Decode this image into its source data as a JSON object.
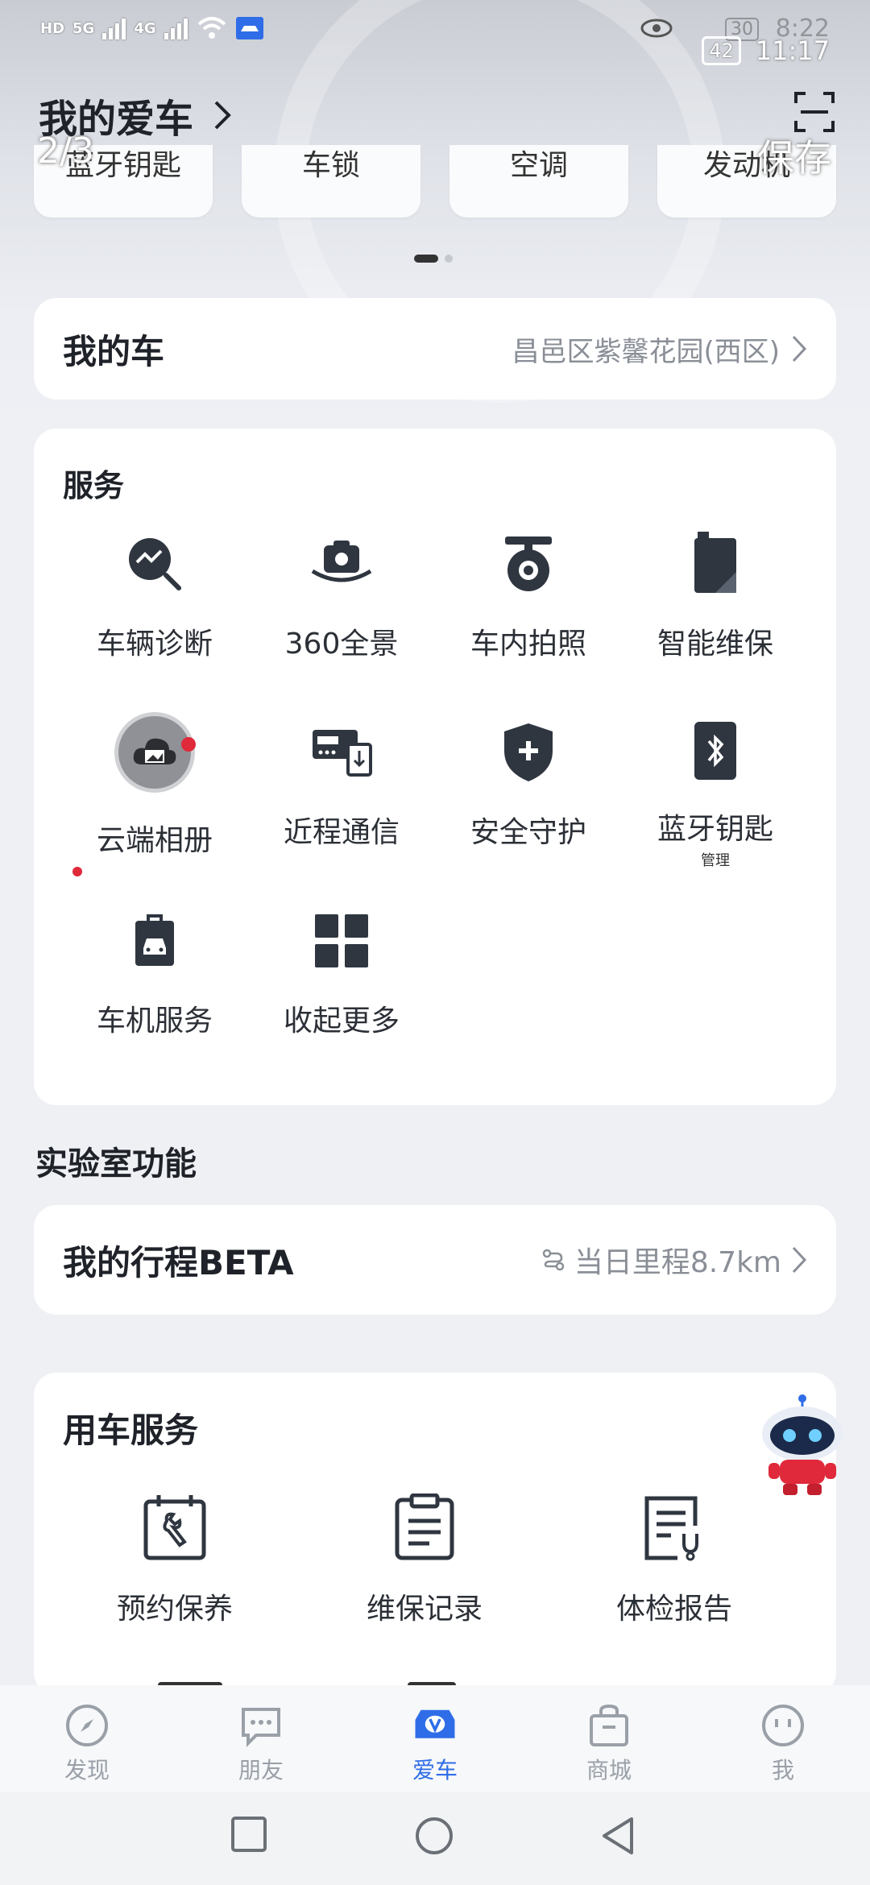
{
  "status_bar": {
    "left_chips": [
      "HD",
      "5G",
      "4G",
      "HD"
    ],
    "battery": "42",
    "time": "11:17",
    "ghost_battery": "30",
    "ghost_time": "8:22"
  },
  "header": {
    "title": "我的爱车",
    "page_indicator": "2/3",
    "save_label": "保存"
  },
  "quick_tiles": [
    "蓝牙钥匙",
    "车锁",
    "空调",
    "发动机"
  ],
  "my_car": {
    "title": "我的车",
    "location": "昌邑区紫馨花园(西区)"
  },
  "services": {
    "title": "服务",
    "items": [
      {
        "label": "车辆诊断",
        "icon": "diagnosis-icon"
      },
      {
        "label": "360全景",
        "icon": "camera-360-icon"
      },
      {
        "label": "车内拍照",
        "icon": "in-car-camera-icon"
      },
      {
        "label": "智能维保",
        "icon": "maintenance-icon"
      },
      {
        "label": "云端相册",
        "icon": "cloud-album-icon"
      },
      {
        "label": "近程通信",
        "icon": "near-communication-icon"
      },
      {
        "label": "安全守护",
        "icon": "shield-icon"
      },
      {
        "label": "蓝牙钥匙",
        "icon": "bluetooth-key-icon",
        "sub": "管理"
      },
      {
        "label": "车机服务",
        "icon": "car-service-icon"
      },
      {
        "label": "收起更多",
        "icon": "grid-icon"
      }
    ]
  },
  "lab": {
    "heading": "实验室功能",
    "trip_title": "我的行程BETA",
    "trip_value": "当日里程8.7km"
  },
  "use_car": {
    "title": "用车服务",
    "items": [
      {
        "label": "预约保养",
        "icon": "wrench-calendar-icon"
      },
      {
        "label": "维保记录",
        "icon": "clipboard-icon"
      },
      {
        "label": "体检报告",
        "icon": "health-report-icon"
      }
    ]
  },
  "bottom_nav": [
    {
      "label": "发现",
      "icon": "compass-icon"
    },
    {
      "label": "朋友",
      "icon": "chat-icon"
    },
    {
      "label": "爱车",
      "icon": "car-icon",
      "active": true
    },
    {
      "label": "商城",
      "icon": "shopping-bag-icon"
    },
    {
      "label": "我",
      "icon": "profile-icon"
    }
  ],
  "colors": {
    "accent": "#2f6de8",
    "icon_dark": "#2f3640",
    "red_badge": "#e0293a"
  }
}
